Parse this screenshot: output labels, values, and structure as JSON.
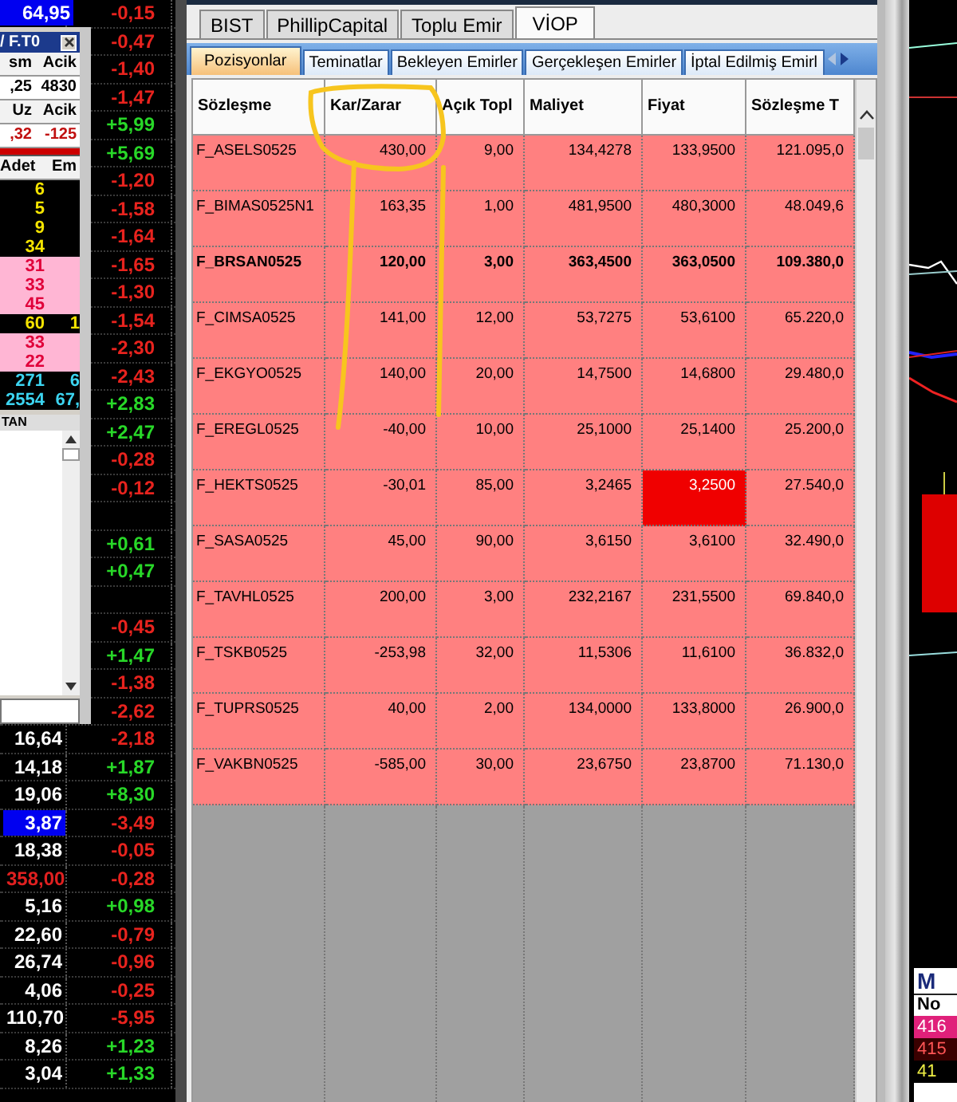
{
  "quotes": {
    "rows": [
      {
        "price": "64,95",
        "selected": true,
        "price_falling": false,
        "change": "-0,15",
        "rising": false
      },
      {
        "change": "-0,47",
        "rising": false
      },
      {
        "change": "-1,40",
        "rising": false
      },
      {
        "change": "-1,47",
        "rising": false
      },
      {
        "change": "+5,99",
        "rising": true
      },
      {
        "change": "+5,69",
        "rising": true
      },
      {
        "change": "-1,20",
        "rising": false
      },
      {
        "change": "-1,58",
        "rising": false
      },
      {
        "change": "-1,64",
        "rising": false
      },
      {
        "change": "-1,65",
        "rising": false
      },
      {
        "change": "-1,30",
        "rising": false
      },
      {
        "change": "-1,54",
        "rising": false
      },
      {
        "change": "-2,30",
        "rising": false
      },
      {
        "change": "-2,43",
        "rising": false
      },
      {
        "change": "+2,83",
        "rising": true
      },
      {
        "change": "+2,47",
        "rising": true
      },
      {
        "change": "-0,28",
        "rising": false
      },
      {
        "change": "-0,12",
        "rising": false
      },
      {},
      {
        "change": "+0,61",
        "rising": true
      },
      {
        "change": "+0,47",
        "rising": true
      },
      {},
      {
        "change": "-0,45",
        "rising": false
      },
      {
        "change": "+1,47",
        "rising": true
      },
      {
        "change": "-1,38",
        "rising": false
      },
      {
        "change": "-2,62",
        "rising": false
      },
      {
        "price": "16,64",
        "selected": false,
        "price_falling": false,
        "change": "-2,18",
        "rising": false
      },
      {
        "price": "14,18",
        "selected": false,
        "price_falling": false,
        "change": "+1,87",
        "rising": true
      },
      {
        "price": "19,06",
        "selected": false,
        "price_falling": false,
        "change": "+8,30",
        "rising": true
      },
      {
        "price": "3,87",
        "selected": true,
        "price_falling": false,
        "change": "-3,49",
        "rising": false
      },
      {
        "price": "18,38",
        "selected": false,
        "price_falling": false,
        "change": "-0,05",
        "rising": false
      },
      {
        "price": "358,00",
        "selected": false,
        "price_falling": true,
        "change": "-0,28",
        "rising": false
      },
      {
        "price": "5,16",
        "selected": false,
        "price_falling": false,
        "change": "+0,98",
        "rising": true
      },
      {
        "price": "22,60",
        "selected": false,
        "price_falling": false,
        "change": "-0,79",
        "rising": false
      },
      {
        "price": "26,74",
        "selected": false,
        "price_falling": false,
        "change": "-0,96",
        "rising": false
      },
      {
        "price": "4,06",
        "selected": false,
        "price_falling": false,
        "change": "-0,25",
        "rising": false
      },
      {
        "price": "110,70",
        "selected": false,
        "price_falling": false,
        "change": "-5,95",
        "rising": false
      },
      {
        "price": "8,26",
        "selected": false,
        "price_falling": false,
        "change": "+1,23",
        "rising": true
      },
      {
        "price": "3,04",
        "selected": false,
        "price_falling": false,
        "change": "+1,33",
        "rising": true
      }
    ]
  },
  "popup": {
    "title": "/ F.T0",
    "summary": [
      {
        "kind": "header",
        "cells": [
          "sm",
          "Acik"
        ]
      },
      {
        "kind": "value",
        "cells": [
          ",25",
          "4830"
        ]
      },
      {
        "kind": "header",
        "cells": [
          "Uz",
          "Acik"
        ]
      },
      {
        "kind": "loss",
        "cells": [
          ",32",
          "-125"
        ]
      }
    ],
    "depth_header": [
      "Adet",
      "Em"
    ],
    "depth_rows": [
      {
        "kind": "bid",
        "cells": [
          "6"
        ]
      },
      {
        "kind": "bid",
        "cells": [
          "5"
        ]
      },
      {
        "kind": "bid",
        "cells": [
          "9"
        ]
      },
      {
        "kind": "bid",
        "cells": [
          "34"
        ]
      },
      {
        "kind": "ask",
        "cells": [
          "31"
        ]
      },
      {
        "kind": "ask",
        "cells": [
          "33"
        ]
      },
      {
        "kind": "ask",
        "cells": [
          "45"
        ]
      },
      {
        "kind": "bid",
        "cells": [
          "60",
          "1"
        ]
      },
      {
        "kind": "ask",
        "cells": [
          "33"
        ]
      },
      {
        "kind": "ask",
        "cells": [
          "22"
        ]
      },
      {
        "kind": "total",
        "cells": [
          "271",
          "6"
        ]
      },
      {
        "kind": "total",
        "cells": [
          "2554",
          "67,"
        ]
      }
    ],
    "list_header": "TAN"
  },
  "main_tabs": [
    {
      "label": "BIST",
      "selected": false
    },
    {
      "label": "PhillipCapital",
      "selected": false
    },
    {
      "label": "Toplu Emir",
      "selected": false
    },
    {
      "label": "VİOP",
      "selected": true
    }
  ],
  "sub_tabs": [
    {
      "label": "Pozisyonlar",
      "selected": true
    },
    {
      "label": "Teminatlar",
      "selected": false
    },
    {
      "label": "Bekleyen Emirler",
      "selected": false
    },
    {
      "label": "Gerçekleşen Emirler",
      "selected": false
    },
    {
      "label": "İptal Edilmiş Emirl",
      "selected": false
    }
  ],
  "table": {
    "columns": [
      "Sözleşme",
      "Kar/Zarar",
      "Açık Topl",
      "Maliyet",
      "Fiyat",
      "Sözleşme T"
    ],
    "rows": [
      {
        "bold": false,
        "price_flash": false,
        "cells": [
          "F_ASELS0525",
          "430,00",
          "9,00",
          "134,4278",
          "133,9500",
          "121.095,0"
        ]
      },
      {
        "bold": false,
        "price_flash": false,
        "cells": [
          "F_BIMAS0525N1",
          "163,35",
          "1,00",
          "481,9500",
          "480,3000",
          "48.049,6"
        ]
      },
      {
        "bold": true,
        "price_flash": false,
        "cells": [
          "F_BRSAN0525",
          "120,00",
          "3,00",
          "363,4500",
          "363,0500",
          "109.380,0"
        ]
      },
      {
        "bold": false,
        "price_flash": false,
        "cells": [
          "F_CIMSA0525",
          "141,00",
          "12,00",
          "53,7275",
          "53,6100",
          "65.220,0"
        ]
      },
      {
        "bold": false,
        "price_flash": false,
        "cells": [
          "F_EKGYO0525",
          "140,00",
          "20,00",
          "14,7500",
          "14,6800",
          "29.480,0"
        ]
      },
      {
        "bold": false,
        "price_flash": false,
        "cells": [
          "F_EREGL0525",
          "-40,00",
          "10,00",
          "25,1000",
          "25,1400",
          "25.200,0"
        ]
      },
      {
        "bold": false,
        "price_flash": true,
        "cells": [
          "F_HEKTS0525",
          "-30,01",
          "85,00",
          "3,2465",
          "3,2500",
          "27.540,0"
        ]
      },
      {
        "bold": false,
        "price_flash": false,
        "cells": [
          "F_SASA0525",
          "45,00",
          "90,00",
          "3,6150",
          "3,6100",
          "32.490,0"
        ]
      },
      {
        "bold": false,
        "price_flash": false,
        "cells": [
          "F_TAVHL0525",
          "200,00",
          "3,00",
          "232,2167",
          "231,5500",
          "69.840,0"
        ]
      },
      {
        "bold": false,
        "price_flash": false,
        "cells": [
          "F_TSKB0525",
          "-253,98",
          "32,00",
          "11,5306",
          "11,6100",
          "36.832,0"
        ]
      },
      {
        "bold": false,
        "price_flash": false,
        "cells": [
          "F_TUPRS0525",
          "40,00",
          "2,00",
          "134,0000",
          "133,8000",
          "26.900,0"
        ]
      },
      {
        "bold": false,
        "price_flash": false,
        "cells": [
          "F_VAKBN0525",
          "-585,00",
          "30,00",
          "23,6750",
          "23,8700",
          "71.130,0"
        ]
      }
    ]
  },
  "side_panel": {
    "header": "M",
    "label": "No",
    "rows": [
      {
        "kind": "strong",
        "text": "416"
      },
      {
        "kind": "weak",
        "text": "415"
      },
      {
        "kind": "neutral",
        "text": "41"
      }
    ]
  }
}
